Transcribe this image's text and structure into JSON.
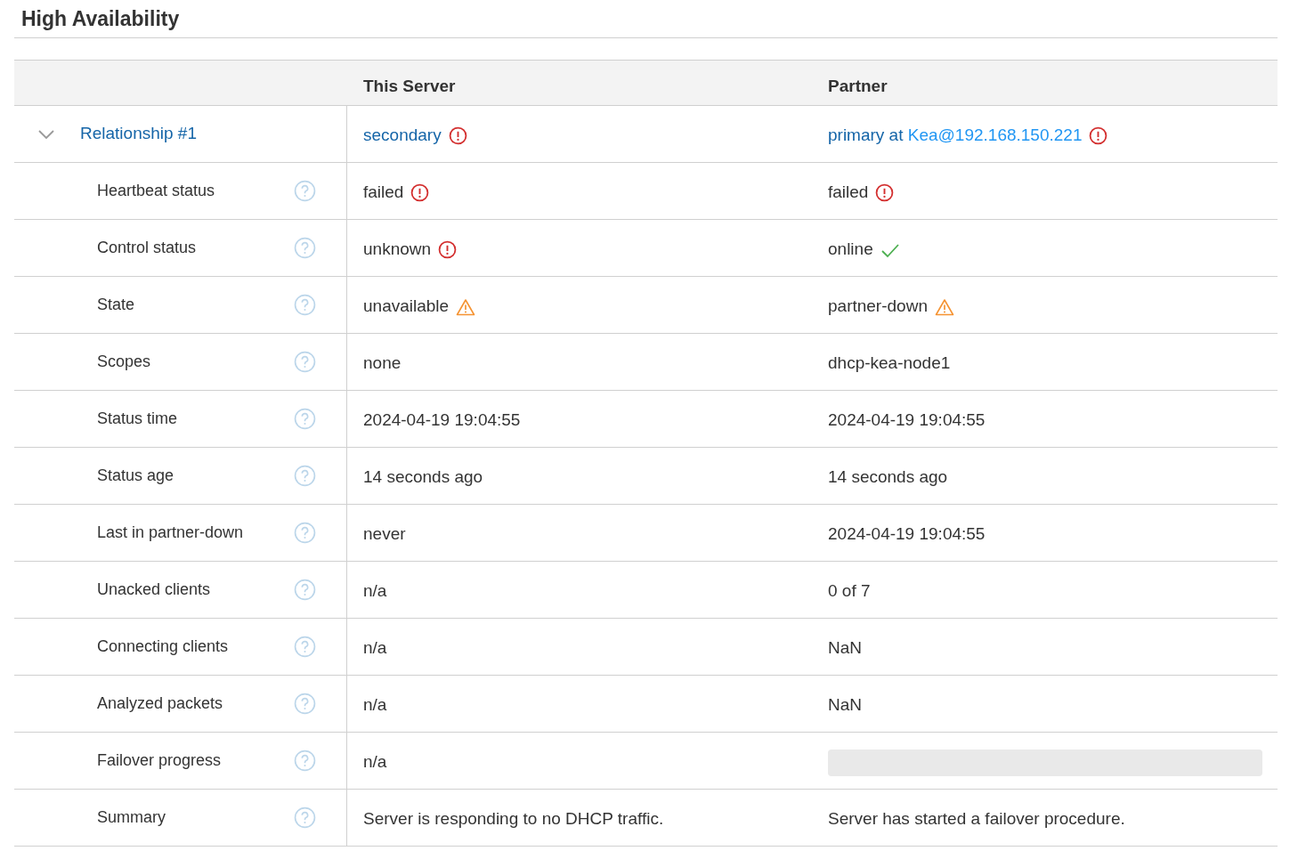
{
  "title": "High Availability",
  "columns": [
    "This Server",
    "Partner"
  ],
  "relationship": {
    "label": "Relationship #1",
    "expanded": true,
    "this_server": {
      "kind": "error",
      "text": "secondary"
    },
    "partner": {
      "kind": "error",
      "text": "primary at ",
      "link": "Kea@192.168.150.221"
    }
  },
  "rows": [
    {
      "label": "Heartbeat status",
      "cells": [
        {
          "kind": "error",
          "text": "failed"
        },
        {
          "kind": "error",
          "text": "failed"
        }
      ]
    },
    {
      "label": "Control status",
      "cells": [
        {
          "kind": "error",
          "text": "unknown"
        },
        {
          "kind": "ok",
          "text": "online"
        }
      ]
    },
    {
      "label": "State",
      "cells": [
        {
          "kind": "warning",
          "text": "unavailable"
        },
        {
          "kind": "warning",
          "text": "partner-down"
        }
      ]
    },
    {
      "label": "Scopes",
      "cells": [
        {
          "kind": "text",
          "text": "none"
        },
        {
          "kind": "text",
          "text": "dhcp-kea-node1"
        }
      ]
    },
    {
      "label": "Status time",
      "cells": [
        {
          "kind": "text",
          "text": "2024-04-19 19:04:55"
        },
        {
          "kind": "text",
          "text": "2024-04-19 19:04:55"
        }
      ]
    },
    {
      "label": "Status age",
      "cells": [
        {
          "kind": "text",
          "text": "14 seconds ago"
        },
        {
          "kind": "text",
          "text": "14 seconds ago"
        }
      ]
    },
    {
      "label": "Last in partner-down",
      "cells": [
        {
          "kind": "text",
          "text": "never"
        },
        {
          "kind": "text",
          "text": "2024-04-19 19:04:55"
        }
      ]
    },
    {
      "label": "Unacked clients",
      "cells": [
        {
          "kind": "text",
          "text": "n/a"
        },
        {
          "kind": "text",
          "text": "0 of 7"
        }
      ]
    },
    {
      "label": "Connecting clients",
      "cells": [
        {
          "kind": "text",
          "text": "n/a"
        },
        {
          "kind": "text",
          "text": "NaN"
        }
      ]
    },
    {
      "label": "Analyzed packets",
      "cells": [
        {
          "kind": "text",
          "text": "n/a"
        },
        {
          "kind": "text",
          "text": "NaN"
        }
      ]
    },
    {
      "label": "Failover progress",
      "cells": [
        {
          "kind": "text",
          "text": "n/a"
        },
        {
          "kind": "progress",
          "level": 0
        }
      ]
    },
    {
      "label": "Summary",
      "cells": [
        {
          "kind": "text",
          "text": "Server is responding to no DHCP traffic."
        },
        {
          "kind": "text",
          "text": "Server has started a failover procedure."
        }
      ]
    }
  ]
}
